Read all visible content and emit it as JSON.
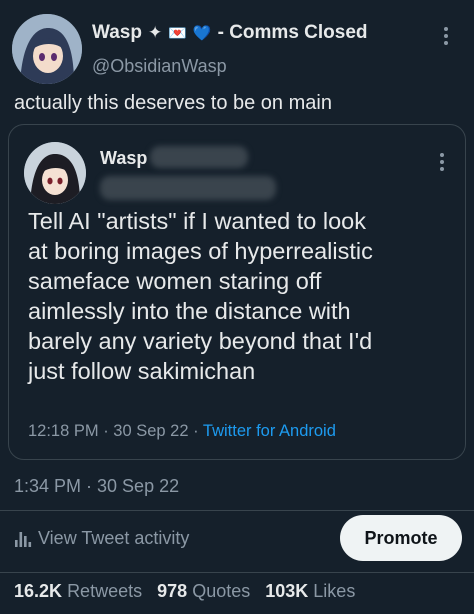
{
  "tweet": {
    "author_name": "Wasp",
    "name_emoji": [
      "✦",
      "💌",
      "💙"
    ],
    "name_suffix": "- Comms Closed",
    "handle": "@ObsidianWasp",
    "text": "actually this deserves to be on main",
    "timestamp": "1:34 PM · 30 Sep 22"
  },
  "quoted": {
    "author_name": "Wasp",
    "text_lines": [
      "Tell AI \"artists\" if I wanted to look",
      "at boring images of hyperrealistic",
      "sameface women staring off",
      "aimlessly into the distance with",
      "barely any variety beyond that I'd",
      "just follow sakimichan"
    ],
    "timestamp": "12:18 PM · 30 Sep 22 ·",
    "source": "Twitter for Android"
  },
  "actions": {
    "activity_label": "View Tweet activity",
    "promote_label": "Promote"
  },
  "stats": {
    "retweets_count": "16.2K",
    "retweets_label": "Retweets",
    "quotes_count": "978",
    "quotes_label": "Quotes",
    "likes_count": "103K",
    "likes_label": "Likes"
  },
  "icons": {
    "more": "more-icon",
    "activity": "bar-chart-icon"
  },
  "colors": {
    "background": "#15202b",
    "link": "#1d9bf0",
    "muted": "#8b98a5"
  }
}
